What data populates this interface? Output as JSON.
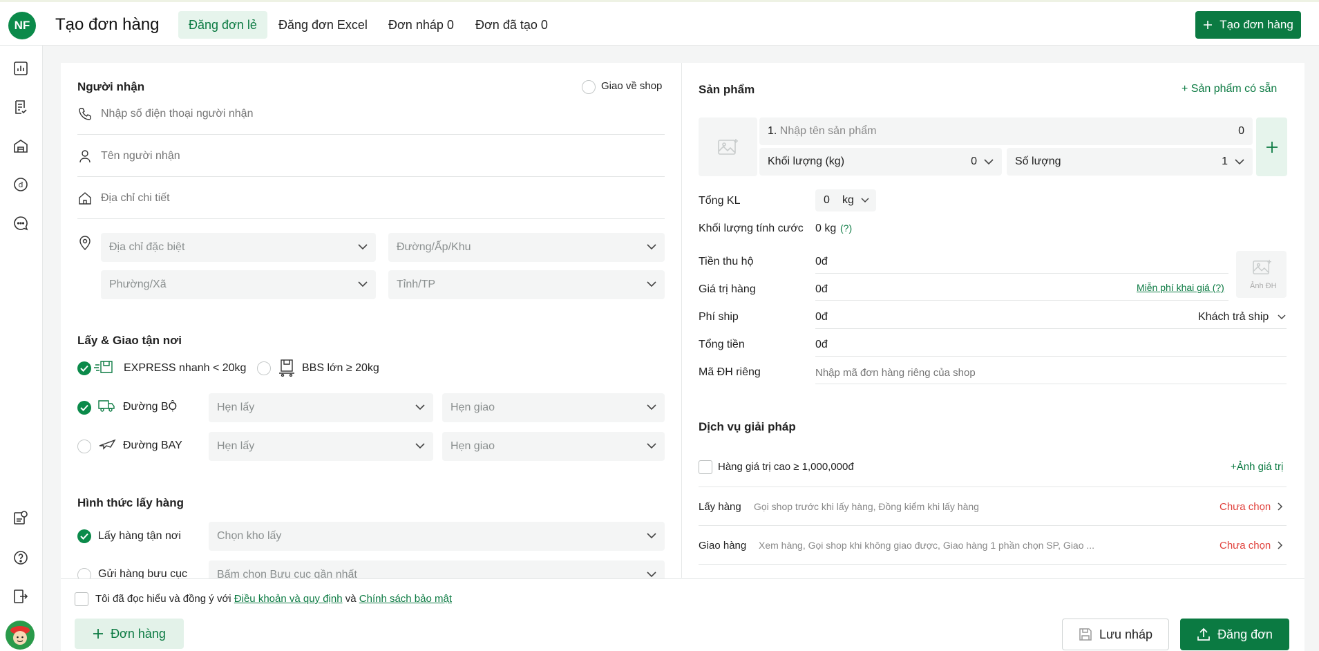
{
  "header": {
    "logo": "NF",
    "title": "Tạo đơn hàng",
    "tabs": [
      {
        "label": "Đăng đơn lẻ"
      },
      {
        "label": "Đăng đơn Excel"
      },
      {
        "label": "Đơn nháp 0"
      },
      {
        "label": "Đơn đã tạo 0"
      }
    ],
    "create_button": "Tạo đơn hàng"
  },
  "sidebar": {
    "icons": [
      "chart-icon",
      "order-list-icon",
      "warehouse-icon",
      "money-icon",
      "chat-icon",
      "report-icon",
      "help-icon",
      "logout-icon",
      "avatar"
    ]
  },
  "recipient": {
    "section_title": "Người nhận",
    "deliver_to_shop": "Giao về shop",
    "phone_placeholder": "Nhập số điện thoại người nhận",
    "name_placeholder": "Tên người nhận",
    "address_placeholder": "Địa chỉ chi tiết",
    "special_address": "Địa chỉ đặc biệt",
    "street": "Đường/Ấp/Khu",
    "ward": "Phường/Xã",
    "province": "Tỉnh/TP"
  },
  "shipping": {
    "section_title": "Lấy & Giao tận nơi",
    "express": "EXPRESS nhanh < 20kg",
    "bbs": "BBS lớn ≥ 20kg",
    "road": "Đường BỘ",
    "air": "Đường BAY",
    "pickup_time": "Hẹn lấy",
    "delivery_time": "Hẹn giao"
  },
  "pickup": {
    "section_title": "Hình thức lấy hàng",
    "at_door": "Lấy hàng tận nơi",
    "choose_warehouse": "Chọn kho lấy",
    "post_office": "Gửi hàng bưu cục",
    "choose_post_office": "Bấm chọn Bưu cục gần nhất"
  },
  "products": {
    "section_title": "Sản phẩm",
    "available_products": "Sản phẩm có sẵn",
    "index": "1.",
    "name_placeholder": "Nhập tên sản phẩm",
    "price": "0",
    "weight_label": "Khối lượng (kg)",
    "weight_value": "0",
    "quantity_label": "Số lượng",
    "quantity_value": "1"
  },
  "totals": {
    "total_weight_label": "Tổng KL",
    "total_weight_value": "0",
    "total_weight_unit": "kg",
    "charge_weight_label": "Khối lượng tính cước",
    "charge_weight_value": "0 kg",
    "charge_weight_help": "(?)",
    "cod_label": "Tiền thu hộ",
    "cod_value": "0đ",
    "goods_value_label": "Giá trị hàng",
    "goods_value_value": "0đ",
    "free_declare": "Miễn phí khai giá (?)",
    "ship_fee_label": "Phí ship",
    "ship_fee_value": "0đ",
    "ship_payer": "Khách trả ship",
    "total_label": "Tổng tiền",
    "total_value": "0đ",
    "own_code_label": "Mã ĐH riêng",
    "own_code_placeholder": "Nhập mã đơn hàng riêng của shop",
    "order_photo": "Ảnh ĐH"
  },
  "services": {
    "section_title": "Dịch vụ giải pháp",
    "high_value": "Hàng giá trị cao ≥ 1,000,000đ",
    "value_photo": "+Ảnh giá trị",
    "pickup_label": "Lấy hàng",
    "pickup_desc": "Gọi shop trước khi lấy hàng, Đồng kiểm khi lấy hàng",
    "pickup_status": "Chưa chọn",
    "delivery_label": "Giao hàng",
    "delivery_desc": "Xem hàng, Gọi shop khi không giao được, Giao hàng 1 phần chọn SP, Giao ...",
    "delivery_status": "Chưa chọn"
  },
  "footer": {
    "agree_prefix": "Tôi đã đọc hiểu và đồng ý với",
    "terms": "Điều khoản và quy định",
    "and": "và",
    "privacy": "Chính sách bảo mật",
    "add_order": "Đơn hàng",
    "save_draft": "Lưu nháp",
    "submit": "Đăng đơn"
  },
  "colors": {
    "primary": "#0b7a42",
    "accent_bg": "#e6f4ec",
    "warning": "#e0413c"
  }
}
